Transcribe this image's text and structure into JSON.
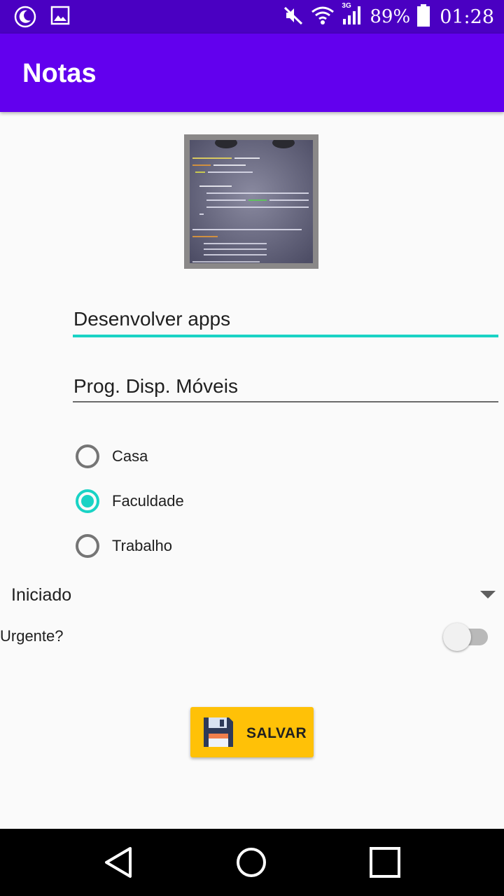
{
  "status_bar": {
    "battery": "89%",
    "time": "01:28",
    "network_type": "3G",
    "icons": [
      "moon-icon",
      "image-icon",
      "mute-icon",
      "wifi-icon",
      "signal-icon",
      "battery-icon"
    ]
  },
  "app_bar": {
    "title": "Notas",
    "color": "#6200ee"
  },
  "photo": {
    "icon": "note-photo"
  },
  "form": {
    "title_value": "Desenvolver apps",
    "subject_value": "Prog. Disp. Móveis",
    "accent_color": "#19d3c5",
    "categories": [
      {
        "label": "Casa",
        "checked": false
      },
      {
        "label": "Faculdade",
        "checked": true
      },
      {
        "label": "Trabalho",
        "checked": false
      }
    ],
    "status_selected": "Iniciado",
    "urgent_label": "Urgente?",
    "urgent_on": false
  },
  "actions": {
    "save_label": "SALVAR",
    "save_color": "#ffc107"
  },
  "nav_bar": {
    "buttons": [
      "back-icon",
      "home-icon",
      "recents-icon"
    ]
  }
}
